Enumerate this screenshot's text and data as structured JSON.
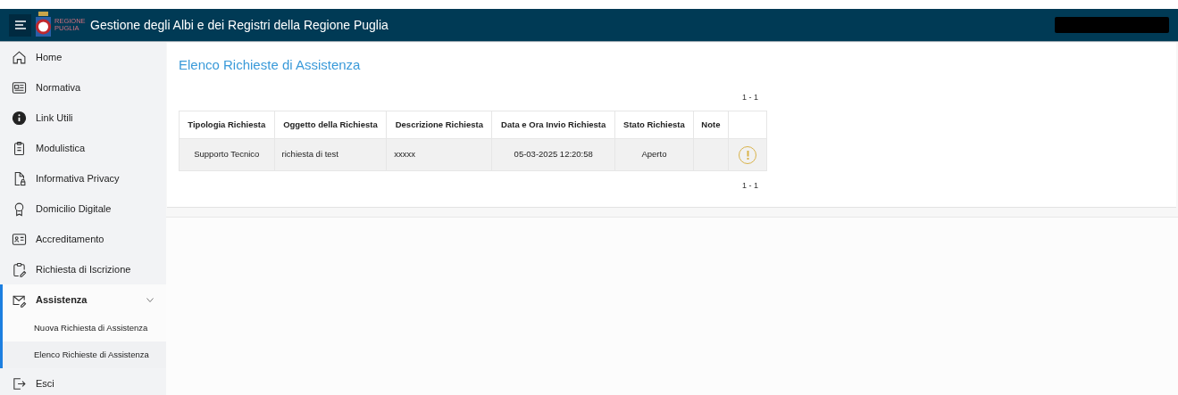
{
  "header": {
    "logo_text": "REGIONE PUGLIA",
    "title": "Gestione degli Albi e dei Registri della Regione Puglia"
  },
  "sidebar": {
    "items": [
      {
        "kind": "home",
        "label": "Home",
        "selected": false
      },
      {
        "kind": "news",
        "label": "Normativa",
        "selected": false
      },
      {
        "kind": "info",
        "label": "Link Utili",
        "selected": false
      },
      {
        "kind": "clipboard",
        "label": "Modulistica",
        "selected": false
      },
      {
        "kind": "filelock",
        "label": "Informativa Privacy",
        "selected": false
      },
      {
        "kind": "award",
        "label": "Domicilio Digitale",
        "selected": false
      },
      {
        "kind": "idcard",
        "label": "Accreditamento",
        "selected": false
      },
      {
        "kind": "clipedit",
        "label": "Richiesta di Iscrizione",
        "selected": false
      },
      {
        "kind": "mail",
        "label": "Assistenza",
        "selected": true,
        "expanded": true,
        "children": [
          {
            "label": "Nuova Richiesta di Assistenza",
            "selected": false
          },
          {
            "label": "Elenco Richieste di Assistenza",
            "selected": true
          }
        ]
      },
      {
        "kind": "logout",
        "label": "Esci",
        "selected": false
      }
    ]
  },
  "page": {
    "title": "Elenco Richieste di Assistenza",
    "pager_top": "1 - 1",
    "pager_bottom": "1 - 1",
    "table": {
      "columns": [
        "Tipologia Richiesta",
        "Oggetto della Richiesta",
        "Descrizione Richiesta",
        "Data e Ora Invio Richiesta",
        "Stato Richiesta",
        "Note"
      ],
      "rows": [
        {
          "cells": [
            "Supporto Tecnico",
            "richiesta di test",
            "xxxxx",
            "05-03-2025 12:20:58",
            "Aperto",
            ""
          ]
        }
      ]
    }
  }
}
